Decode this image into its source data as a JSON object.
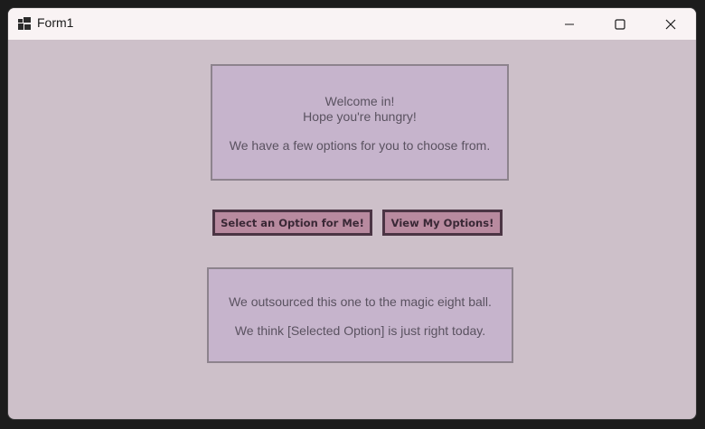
{
  "window": {
    "title": "Form1"
  },
  "welcome_panel": {
    "line1": "Welcome in!",
    "line2": "Hope you're hungry!",
    "line3": "We have a few options for you to choose from."
  },
  "buttons": {
    "select_label": "Select an Option for Me!",
    "view_label": "View My Options!"
  },
  "result_panel": {
    "line1": "We outsourced this one to the magic eight ball.",
    "line2": "We think [Selected Option] is just right today."
  },
  "colors": {
    "form_background": "#cdc0c9",
    "panel_background": "#c6b4cc",
    "button_background": "#b88a9f",
    "button_border": "#4b3544"
  }
}
